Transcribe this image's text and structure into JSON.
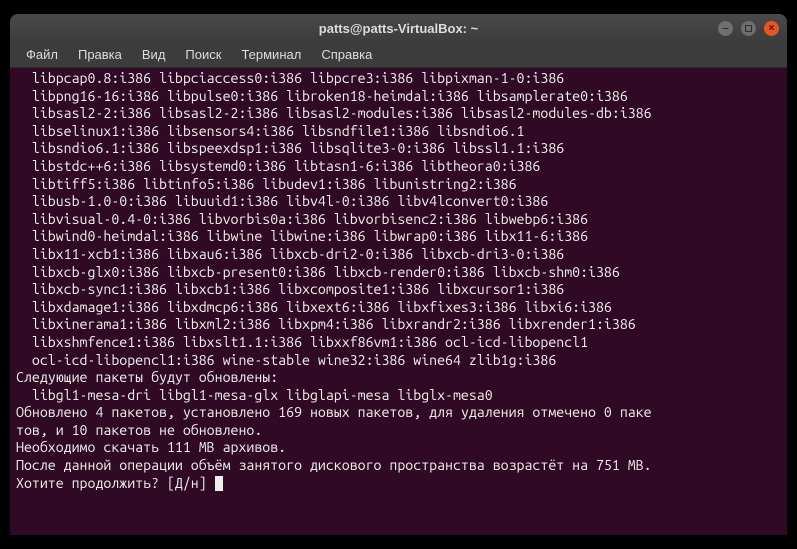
{
  "window": {
    "title": "patts@patts-VirtualBox: ~"
  },
  "menubar": {
    "items": [
      {
        "label": "Файл"
      },
      {
        "label": "Правка"
      },
      {
        "label": "Вид"
      },
      {
        "label": "Поиск"
      },
      {
        "label": "Терминал"
      },
      {
        "label": "Справка"
      }
    ]
  },
  "terminal": {
    "lines": [
      "  libpcap0.8:i386 libpciaccess0:i386 libpcre3:i386 libpixman-1-0:i386",
      "  libpng16-16:i386 libpulse0:i386 libroken18-heimdal:i386 libsamplerate0:i386",
      "  libsasl2-2:i386 libsasl2-2:i386 libsasl2-modules:i386 libsasl2-modules-db:i386",
      "  libselinux1:i386 libsensors4:i386 libsndfile1:i386 libsndio6.1",
      "  libsndio6.1:i386 libspeexdsp1:i386 libsqlite3-0:i386 libssl1.1:i386",
      "  libstdc++6:i386 libsystemd0:i386 libtasn1-6:i386 libtheora0:i386",
      "  libtiff5:i386 libtinfo5:i386 libudev1:i386 libunistring2:i386",
      "  libusb-1.0-0:i386 libuuid1:i386 libv4l-0:i386 libv4lconvert0:i386",
      "  libvisual-0.4-0:i386 libvorbis0a:i386 libvorbisenc2:i386 libwebp6:i386",
      "  libwind0-heimdal:i386 libwine libwine:i386 libwrap0:i386 libx11-6:i386",
      "  libx11-xcb1:i386 libxau6:i386 libxcb-dri2-0:i386 libxcb-dri3-0:i386",
      "  libxcb-glx0:i386 libxcb-present0:i386 libxcb-render0:i386 libxcb-shm0:i386",
      "  libxcb-sync1:i386 libxcb1:i386 libxcomposite1:i386 libxcursor1:i386",
      "  libxdamage1:i386 libxdmcp6:i386 libxext6:i386 libxfixes3:i386 libxi6:i386",
      "  libxinerama1:i386 libxml2:i386 libxpm4:i386 libxrandr2:i386 libxrender1:i386",
      "  libxshmfence1:i386 libxslt1.1:i386 libxxf86vm1:i386 ocl-icd-libopencl1",
      "  ocl-icd-libopencl1:i386 wine-stable wine32:i386 wine64 zlib1g:i386",
      "Следующие пакеты будут обновлены:",
      "  libgl1-mesa-dri libgl1-mesa-glx libglapi-mesa libglx-mesa0",
      "Обновлено 4 пакетов, установлено 169 новых пакетов, для удаления отмечено 0 паке",
      "тов, и 10 пакетов не обновлено.",
      "Необходимо скачать 111 MB архивов.",
      "После данной операции объём занятого дискового пространства возрастёт на 751 MB.",
      "Хотите продолжить? [Д/н] "
    ]
  }
}
